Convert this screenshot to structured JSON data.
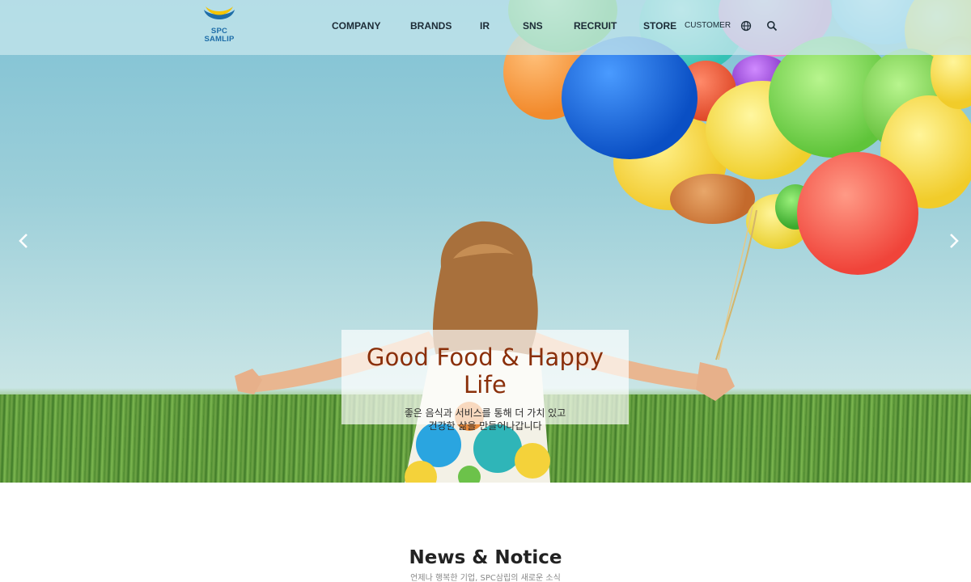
{
  "header": {
    "logo": {
      "line1": "SPC",
      "line2": "SAMLIP"
    },
    "nav": [
      {
        "label": "COMPANY"
      },
      {
        "label": "BRANDS"
      },
      {
        "label": "IR"
      },
      {
        "label": "SNS"
      },
      {
        "label": "RECRUIT"
      },
      {
        "label": "STORE"
      }
    ],
    "customer_label": "CUSTOMER",
    "icons": [
      "globe-icon",
      "search-icon"
    ]
  },
  "hero": {
    "title": "Good Food & Happy Life",
    "subtitle_line1": "좋은 음식과 서비스를 통해 더 가치 있고",
    "subtitle_line2": "건강한 삶을 만들어나갑니다",
    "prev_icon": "chevron-left-icon",
    "next_icon": "chevron-right-icon"
  },
  "news": {
    "title": "News & Notice",
    "subtitle": "언제나 행복한 기업, SPC삼립의 새로운 소식"
  },
  "colors": {
    "caption_title": "#8a2f0a",
    "logo_blue": "#1e6da8",
    "logo_yellow": "#f5c400"
  }
}
